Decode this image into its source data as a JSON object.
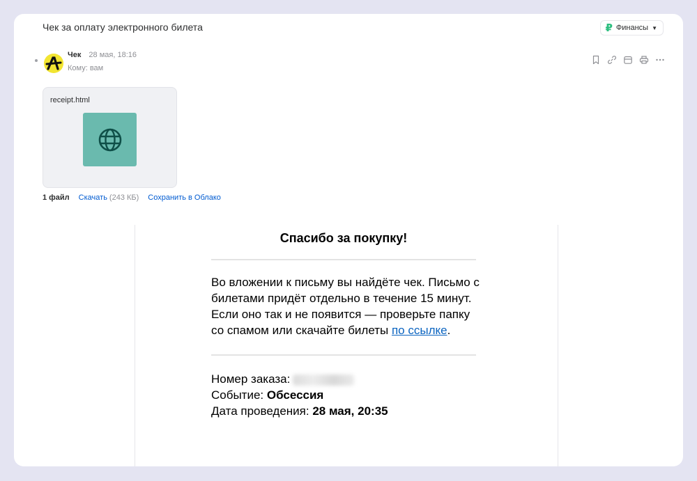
{
  "message": {
    "subject": "Чек за оплату электронного билета",
    "folder_label": "Финансы",
    "folder_icon": "ruble-icon",
    "sender_name": "Чек",
    "date": "28 мая, 18:16",
    "to_line": "Кому: вам"
  },
  "toolbar": {
    "icons": [
      "bookmark-icon",
      "link-icon",
      "calendar-icon",
      "print-icon",
      "more-icon"
    ]
  },
  "attachment": {
    "filename": "receipt.html",
    "icon": "globe-icon",
    "files_count": "1 файл",
    "download_label": "Скачать",
    "size": "(243 КБ)",
    "save_cloud_label": "Сохранить в Облако"
  },
  "body": {
    "heading": "Спасибо за покупку!",
    "paragraph_text": "Во вложении к письму вы найдёте чек. Письмо с билетами придёт отдельно в течение 15 минут. Если оно так и не появится — проверьте папку со спамом или скачайте билеты ",
    "paragraph_link": "по ссылке",
    "paragraph_end": ".",
    "order_label": "Номер заказа:",
    "event_label": "Событие:",
    "event_value": "Обсессия",
    "date_label": "Дата проведения:",
    "date_value": "28 мая, 20:35"
  },
  "colors": {
    "background": "#e4e4f2",
    "accent_link": "#005bd1",
    "attachment_thumb": "#6abaae",
    "avatar_bg": "#f2e532",
    "folder_icon": "#2bbd7e"
  }
}
